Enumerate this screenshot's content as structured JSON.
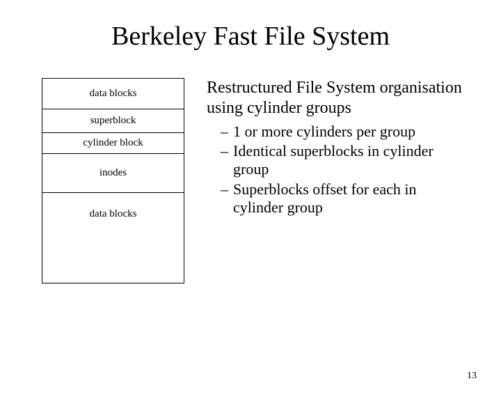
{
  "title": "Berkeley Fast File System",
  "diagram": {
    "rows": [
      "data blocks",
      "superblock",
      "cylinder block",
      "inodes",
      "data blocks"
    ]
  },
  "intro": "Restructured File System organisation using cylinder groups",
  "bullets": [
    "1 or more cylinders per group",
    "Identical superblocks in cylinder group",
    "Superblocks offset for each in cylinder group"
  ],
  "page_number": "13"
}
